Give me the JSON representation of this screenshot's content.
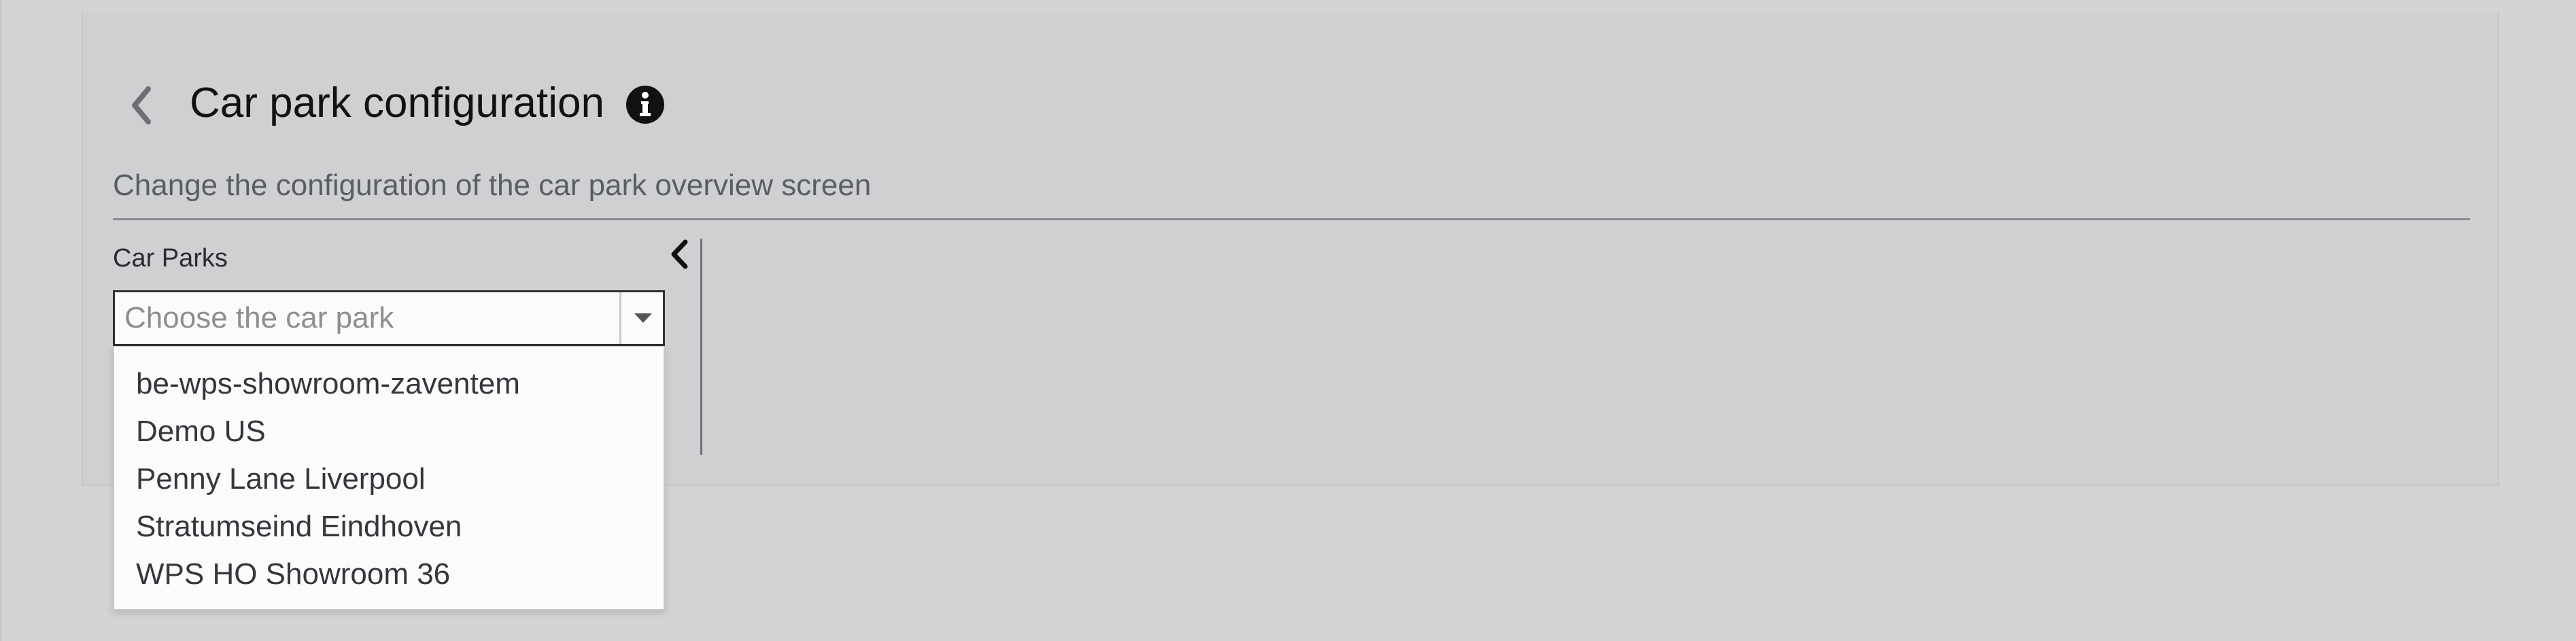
{
  "header": {
    "title": "Car park configuration",
    "subtitle": "Change the configuration of the car park overview screen"
  },
  "car_parks": {
    "label": "Car Parks",
    "placeholder": "Choose the car park",
    "options": [
      "be-wps-showroom-zaventem",
      "Demo US",
      "Penny Lane Liverpool",
      "Stratumseind Eindhoven",
      "WPS HO Showroom 36"
    ]
  },
  "icons": {
    "back": "chevron-left-icon",
    "info": "info-circle-icon",
    "collapse": "chevron-left-icon",
    "dropdown": "caret-down-icon"
  },
  "colors": {
    "background": "#d3d4d6",
    "panel": "#cfd0d2",
    "text_primary": "#111111",
    "text_secondary": "#5a5d63",
    "dropdown_bg": "#fbfbfb"
  }
}
